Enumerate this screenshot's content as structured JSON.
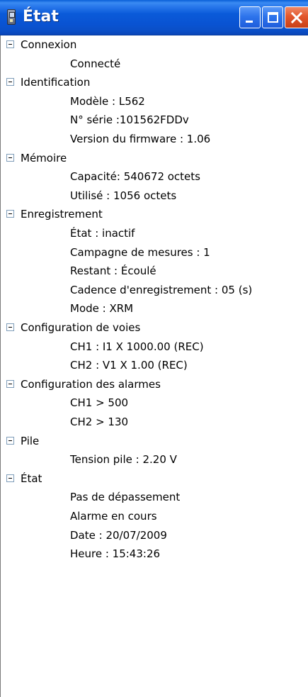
{
  "window": {
    "title": "État",
    "icon": "device-icon",
    "controls": {
      "minimize": "minimize-icon",
      "maximize": "maximize-icon",
      "close": "close-icon"
    }
  },
  "tree": {
    "groups": [
      {
        "label": "Connexion",
        "items": [
          "Connecté"
        ]
      },
      {
        "label": "Identification",
        "items": [
          "Modèle : L562",
          "N° série :101562FDDv",
          "Version du firmware : 1.06"
        ]
      },
      {
        "label": "Mémoire",
        "items": [
          "Capacité: 540672 octets",
          "Utilisé : 1056 octets"
        ]
      },
      {
        "label": "Enregistrement",
        "items": [
          "État : inactif",
          "Campagne de mesures : 1",
          "Restant : Écoulé",
          "Cadence d'enregistrement : 05 (s)",
          "Mode : XRM"
        ]
      },
      {
        "label": "Configuration de voies",
        "items": [
          "CH1 :  I1 X 1000.00 (REC)",
          "CH2 :  V1 X 1.00 (REC)"
        ]
      },
      {
        "label": "Configuration des alarmes",
        "items": [
          "CH1 > 500",
          "CH2 > 130"
        ]
      },
      {
        "label": "Pile",
        "items": [
          "Tension pile : 2.20 V"
        ]
      },
      {
        "label": "État",
        "items": [
          "Pas de dépassement",
          "Alarme en cours",
          "Date : 20/07/2009",
          "Heure : 15:43:26"
        ]
      }
    ]
  },
  "colors": {
    "titlebar": "#0a5ad9",
    "close_button": "#e2572d",
    "background": "#ffffff"
  }
}
